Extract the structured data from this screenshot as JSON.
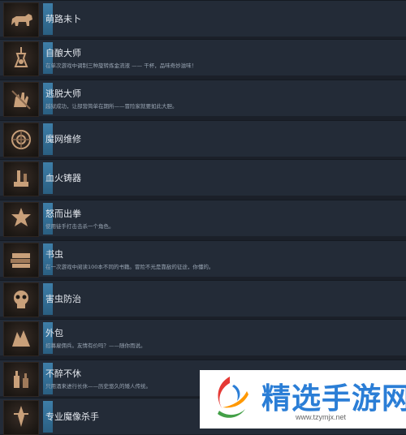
{
  "achievements": [
    {
      "icon": "bear-icon",
      "title": "萌路未卜",
      "desc": ""
    },
    {
      "icon": "alchemy-flask-icon",
      "title": "自酿大师",
      "desc": "在单次游戏中调制三种旋转炼金流液 —— 干杯，品味奇妙滋味！"
    },
    {
      "icon": "escape-hand-icon",
      "title": "逃脱大师",
      "desc": "越狱成功，让部营简单在期所——冒险家就要如此大胆。"
    },
    {
      "icon": "magic-web-icon",
      "title": "魔网维修",
      "desc": ""
    },
    {
      "icon": "blood-forge-icon",
      "title": "血火铸器",
      "desc": ""
    },
    {
      "icon": "fist-icon",
      "title": "怒而出拳",
      "desc": "使用徒手打击击杀一个角色。"
    },
    {
      "icon": "book-icon",
      "title": "书虫",
      "desc": "在一次游戏中阅读100本不同的书籍。冒险不光是靠敌的征途，你懂的。"
    },
    {
      "icon": "pest-skull-icon",
      "title": "害虫防治",
      "desc": ""
    },
    {
      "icon": "outsource-icon",
      "title": "外包",
      "desc": "招募雇佣兵。友情有价吗？——随你而说。"
    },
    {
      "icon": "bottles-icon",
      "title": "不醉不休",
      "desc": "只用酒来进行长休——历史悠久的矮人传统。"
    },
    {
      "icon": "demon-slayer-icon",
      "title": "专业魔像杀手",
      "desc": ""
    }
  ],
  "watermark": {
    "title": "精选手游网",
    "url": "www.tzymjx.net",
    "logo": "swirl-logo-icon",
    "colors": {
      "blue": "#2b7ed6",
      "red": "#e53935",
      "green": "#43a047",
      "orange": "#ff9800"
    }
  }
}
